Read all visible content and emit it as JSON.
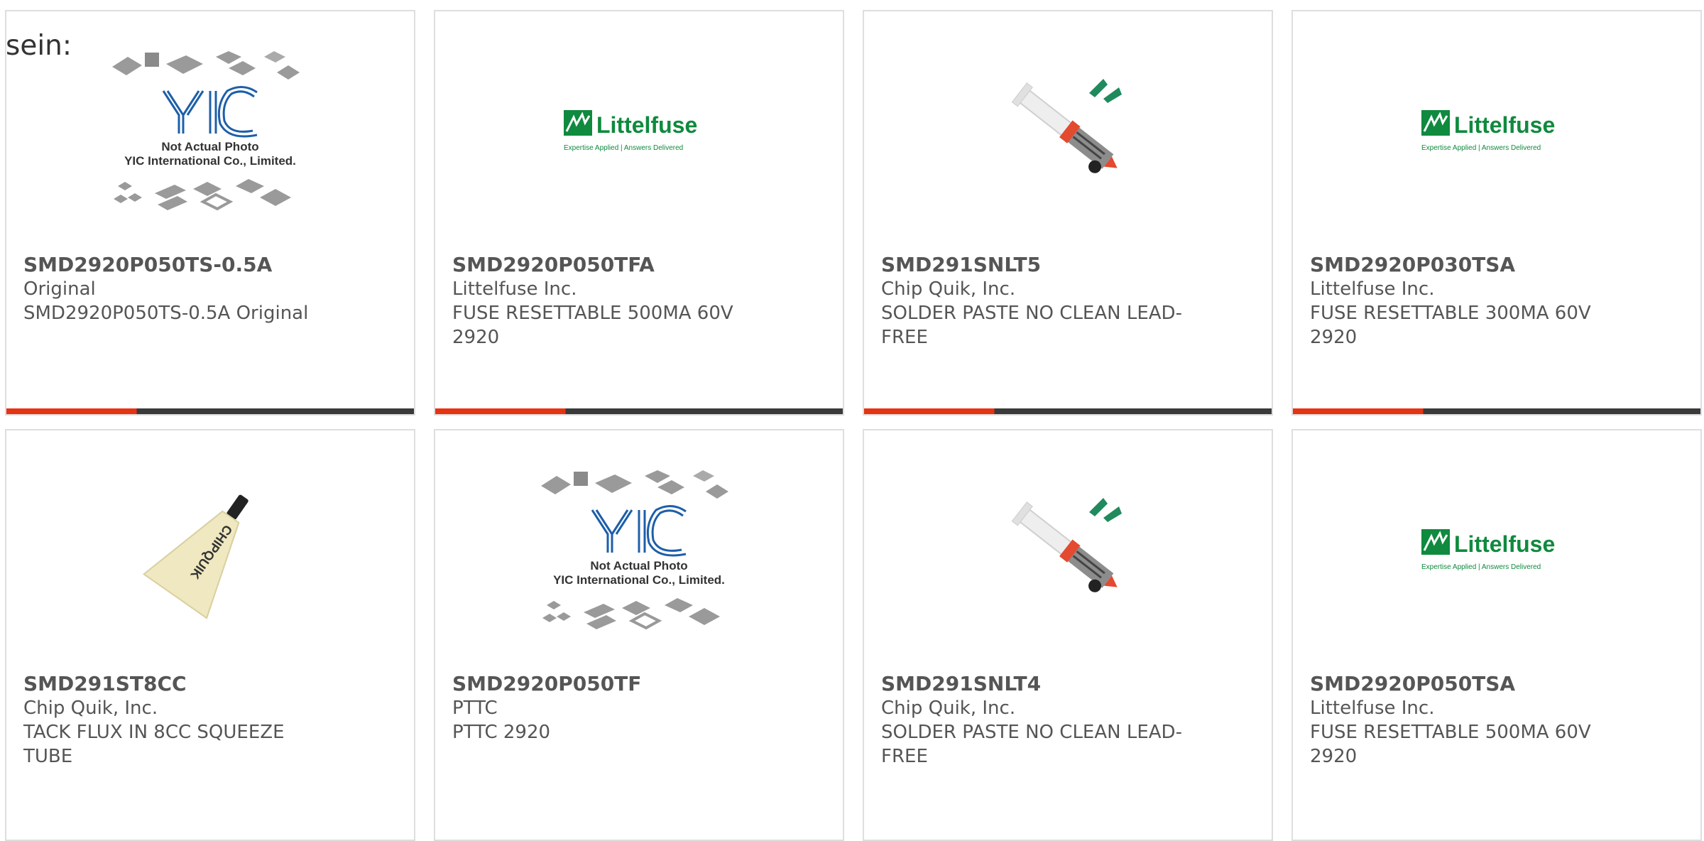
{
  "intro_text": "sein:",
  "colors": {
    "accent": "#e63312",
    "bar_dark": "#3a3a3a",
    "littelfuse_green": "#0f8a3e",
    "yic_blue": "#1d5fa8"
  },
  "logo": {
    "littelfuse_name": "Littelfuse",
    "littelfuse_tagline": "Expertise Applied | Answers Delivered",
    "yic_mark": "YIC",
    "yic_caption_1": "Not Actual Photo",
    "yic_caption_2": "YIC International Co., Limited.",
    "chipquik_label": "CHIPQUIK"
  },
  "products": [
    {
      "part": "SMD2920P050TS-0.5A",
      "manufacturer": "Original",
      "description": "SMD2920P050TS-0.5A Original",
      "image": "yic-placeholder-photo"
    },
    {
      "part": "SMD2920P050TFA",
      "manufacturer": "Littelfuse Inc.",
      "description": "FUSE RESETTABLE 500MA 60V 2920",
      "image": "littelfuse-logo"
    },
    {
      "part": "SMD291SNLT5",
      "manufacturer": "Chip Quik, Inc.",
      "description": "SOLDER PASTE NO CLEAN LEAD-FREE",
      "image": "solder-syringe-photo"
    },
    {
      "part": "SMD2920P030TSA",
      "manufacturer": "Littelfuse Inc.",
      "description": "FUSE RESETTABLE 300MA 60V 2920",
      "image": "littelfuse-logo"
    },
    {
      "part": "SMD291ST8CC",
      "manufacturer": "Chip Quik, Inc.",
      "description": "TACK FLUX IN 8CC SQUEEZE TUBE",
      "image": "flux-tube-photo"
    },
    {
      "part": "SMD2920P050TF",
      "manufacturer": "PTTC",
      "description": "PTTC 2920",
      "image": "yic-placeholder-photo"
    },
    {
      "part": "SMD291SNLT4",
      "manufacturer": "Chip Quik, Inc.",
      "description": "SOLDER PASTE NO CLEAN LEAD-FREE",
      "image": "solder-syringe-photo"
    },
    {
      "part": "SMD2920P050TSA",
      "manufacturer": "Littelfuse Inc.",
      "description": "FUSE RESETTABLE 500MA 60V 2920",
      "image": "littelfuse-logo"
    }
  ]
}
